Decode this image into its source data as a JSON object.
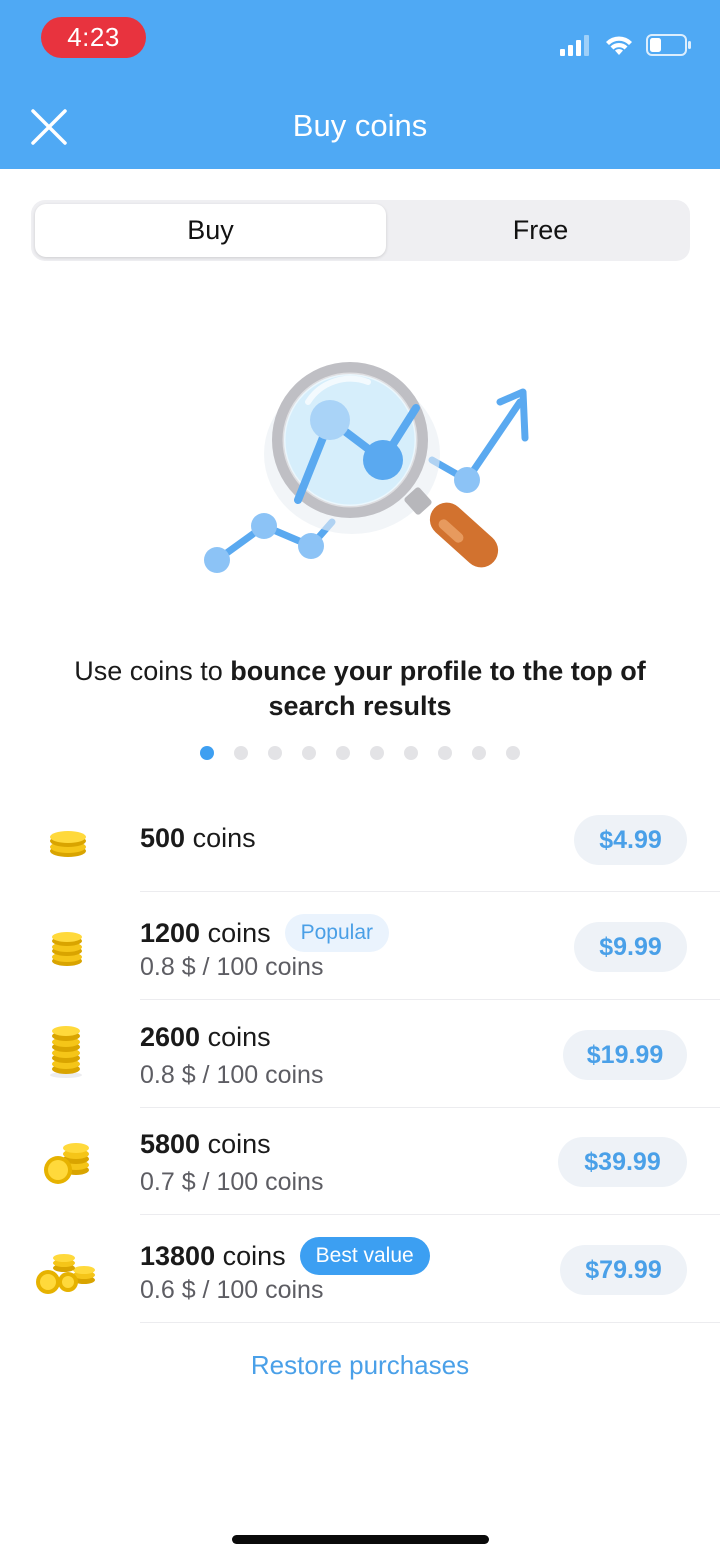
{
  "status_bar": {
    "time": "4:23"
  },
  "header": {
    "title": "Buy coins"
  },
  "tabs": [
    {
      "label": "Buy",
      "active": true
    },
    {
      "label": "Free",
      "active": false
    }
  ],
  "promo": {
    "text_normal": "Use coins to ",
    "text_bold": "bounce your profile to the top of search results",
    "page_count": 10,
    "active_page": 1
  },
  "packages": [
    {
      "count": "500",
      "unit": " coins",
      "rate": "",
      "badge": "",
      "price": "$4.99"
    },
    {
      "count": "1200",
      "unit": " coins",
      "rate": "0.8 $ / 100 coins",
      "badge": "Popular",
      "price": "$9.99"
    },
    {
      "count": "2600",
      "unit": " coins",
      "rate": "0.8 $ / 100 coins",
      "badge": "",
      "price": "$19.99"
    },
    {
      "count": "5800",
      "unit": " coins",
      "rate": "0.7 $ / 100 coins",
      "badge": "",
      "price": "$39.99"
    },
    {
      "count": "13800",
      "unit": " coins",
      "rate": "0.6 $ / 100 coins",
      "badge": "Best value",
      "price": "$79.99"
    }
  ],
  "restore_label": "Restore purchases",
  "colors": {
    "accent": "#4fa9f4",
    "time_pill": "#e8333e",
    "price_text": "#4aa0e8",
    "coin": "#f5c518"
  },
  "icons": [
    "close-icon",
    "signal-icon",
    "wifi-icon",
    "battery-icon",
    "coin-stack-icon"
  ]
}
